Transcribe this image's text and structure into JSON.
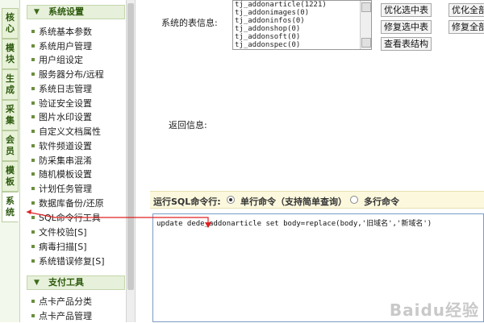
{
  "side_tabs": [
    "核心",
    "模块",
    "生成",
    "采集",
    "会员",
    "模板",
    "系统"
  ],
  "menu": {
    "system_group": "系统设置",
    "items": [
      "系统基本参数",
      "系统用户管理",
      "用户组设定",
      "服务器分布/远程",
      "系统日志管理",
      "验证安全设置",
      "图片水印设置",
      "自定义文档属性",
      "软件频道设置",
      "防采集串混淆",
      "随机模板设置",
      "计划任务管理",
      "数据库备份/还原",
      "SQL命令行工具",
      "文件校验[S]",
      "病毒扫描[S]",
      "系统错误修复[S]"
    ],
    "pay_group": "支付工具",
    "pay_items": [
      "点卡产品分类",
      "点卡产品管理"
    ]
  },
  "main": {
    "table_info_label": "系统的表信息:",
    "tables": [
      "tj_addonarticle(1221)",
      "tj_addonimages(0)",
      "tj_addoninfos(0)",
      "tj_addonshop(0)",
      "tj_addonsoft(0)",
      "tj_addonspec(0)"
    ],
    "buttons": {
      "optimize_selected": "优化选中表",
      "optimize_all": "优化全部表",
      "repair_selected": "修复选中表",
      "repair_all": "修复全部表",
      "view_structure": "查看表结构"
    },
    "return_label": "返回信息:",
    "sql_label": "运行SQL命令行:",
    "mode_single": "单行命令（支持简单查询）",
    "mode_multi": "多行命令",
    "sql_text": "update dede_addonarticle set body=replace(body,'旧域名','新域名')"
  },
  "watermark": "Baidu经验"
}
